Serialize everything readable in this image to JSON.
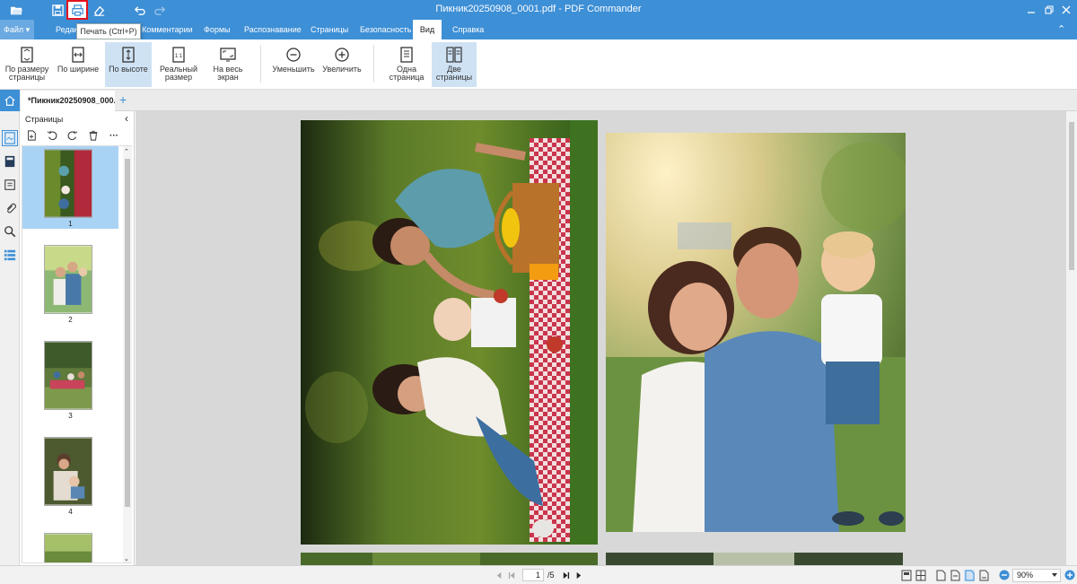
{
  "window": {
    "title": "Пикник20250908_0001.pdf - PDF Commander"
  },
  "quick_access": {
    "open_icon": "folder-open-icon",
    "save_icon": "save-icon",
    "print_icon": "printer-icon",
    "eraser_icon": "eraser-icon",
    "undo_icon": "undo-icon",
    "redo_icon": "redo-icon"
  },
  "tooltip": "Печать (Ctrl+P)",
  "menu_tabs": {
    "file": "Файл",
    "editor": "Редактор",
    "comments": "Комментарии",
    "forms": "Формы",
    "recognition": "Распознавание",
    "pages": "Страницы",
    "security": "Безопасность",
    "view": "Вид",
    "help": "Справка"
  },
  "ribbon": {
    "fit_page_1": "По размеру",
    "fit_page_2": "страницы",
    "fit_width": "По ширине",
    "fit_height": "По высоте",
    "actual_size_1": "Реальный",
    "actual_size_2": "размер",
    "fullscreen_1": "На весь",
    "fullscreen_2": "экран",
    "zoom_out": "Уменьшить",
    "zoom_in": "Увеличить",
    "single_page_1": "Одна",
    "single_page_2": "страница",
    "two_pages_1": "Две",
    "two_pages_2": "страницы",
    "active": "По высоте"
  },
  "document_tab": {
    "name": "*Пикник20250908_000..."
  },
  "pages_panel": {
    "title": "Страницы",
    "thumbnails": [
      {
        "number": "1",
        "selected": true
      },
      {
        "number": "2",
        "selected": false
      },
      {
        "number": "3",
        "selected": false
      },
      {
        "number": "4",
        "selected": false
      }
    ]
  },
  "status": {
    "current_page": "1",
    "total_pages": "/5",
    "zoom": "90%"
  },
  "colors": {
    "accent": "#3d8fd6",
    "highlight": "#e3121b",
    "thumbnail_selected": "#a9d3f5"
  }
}
